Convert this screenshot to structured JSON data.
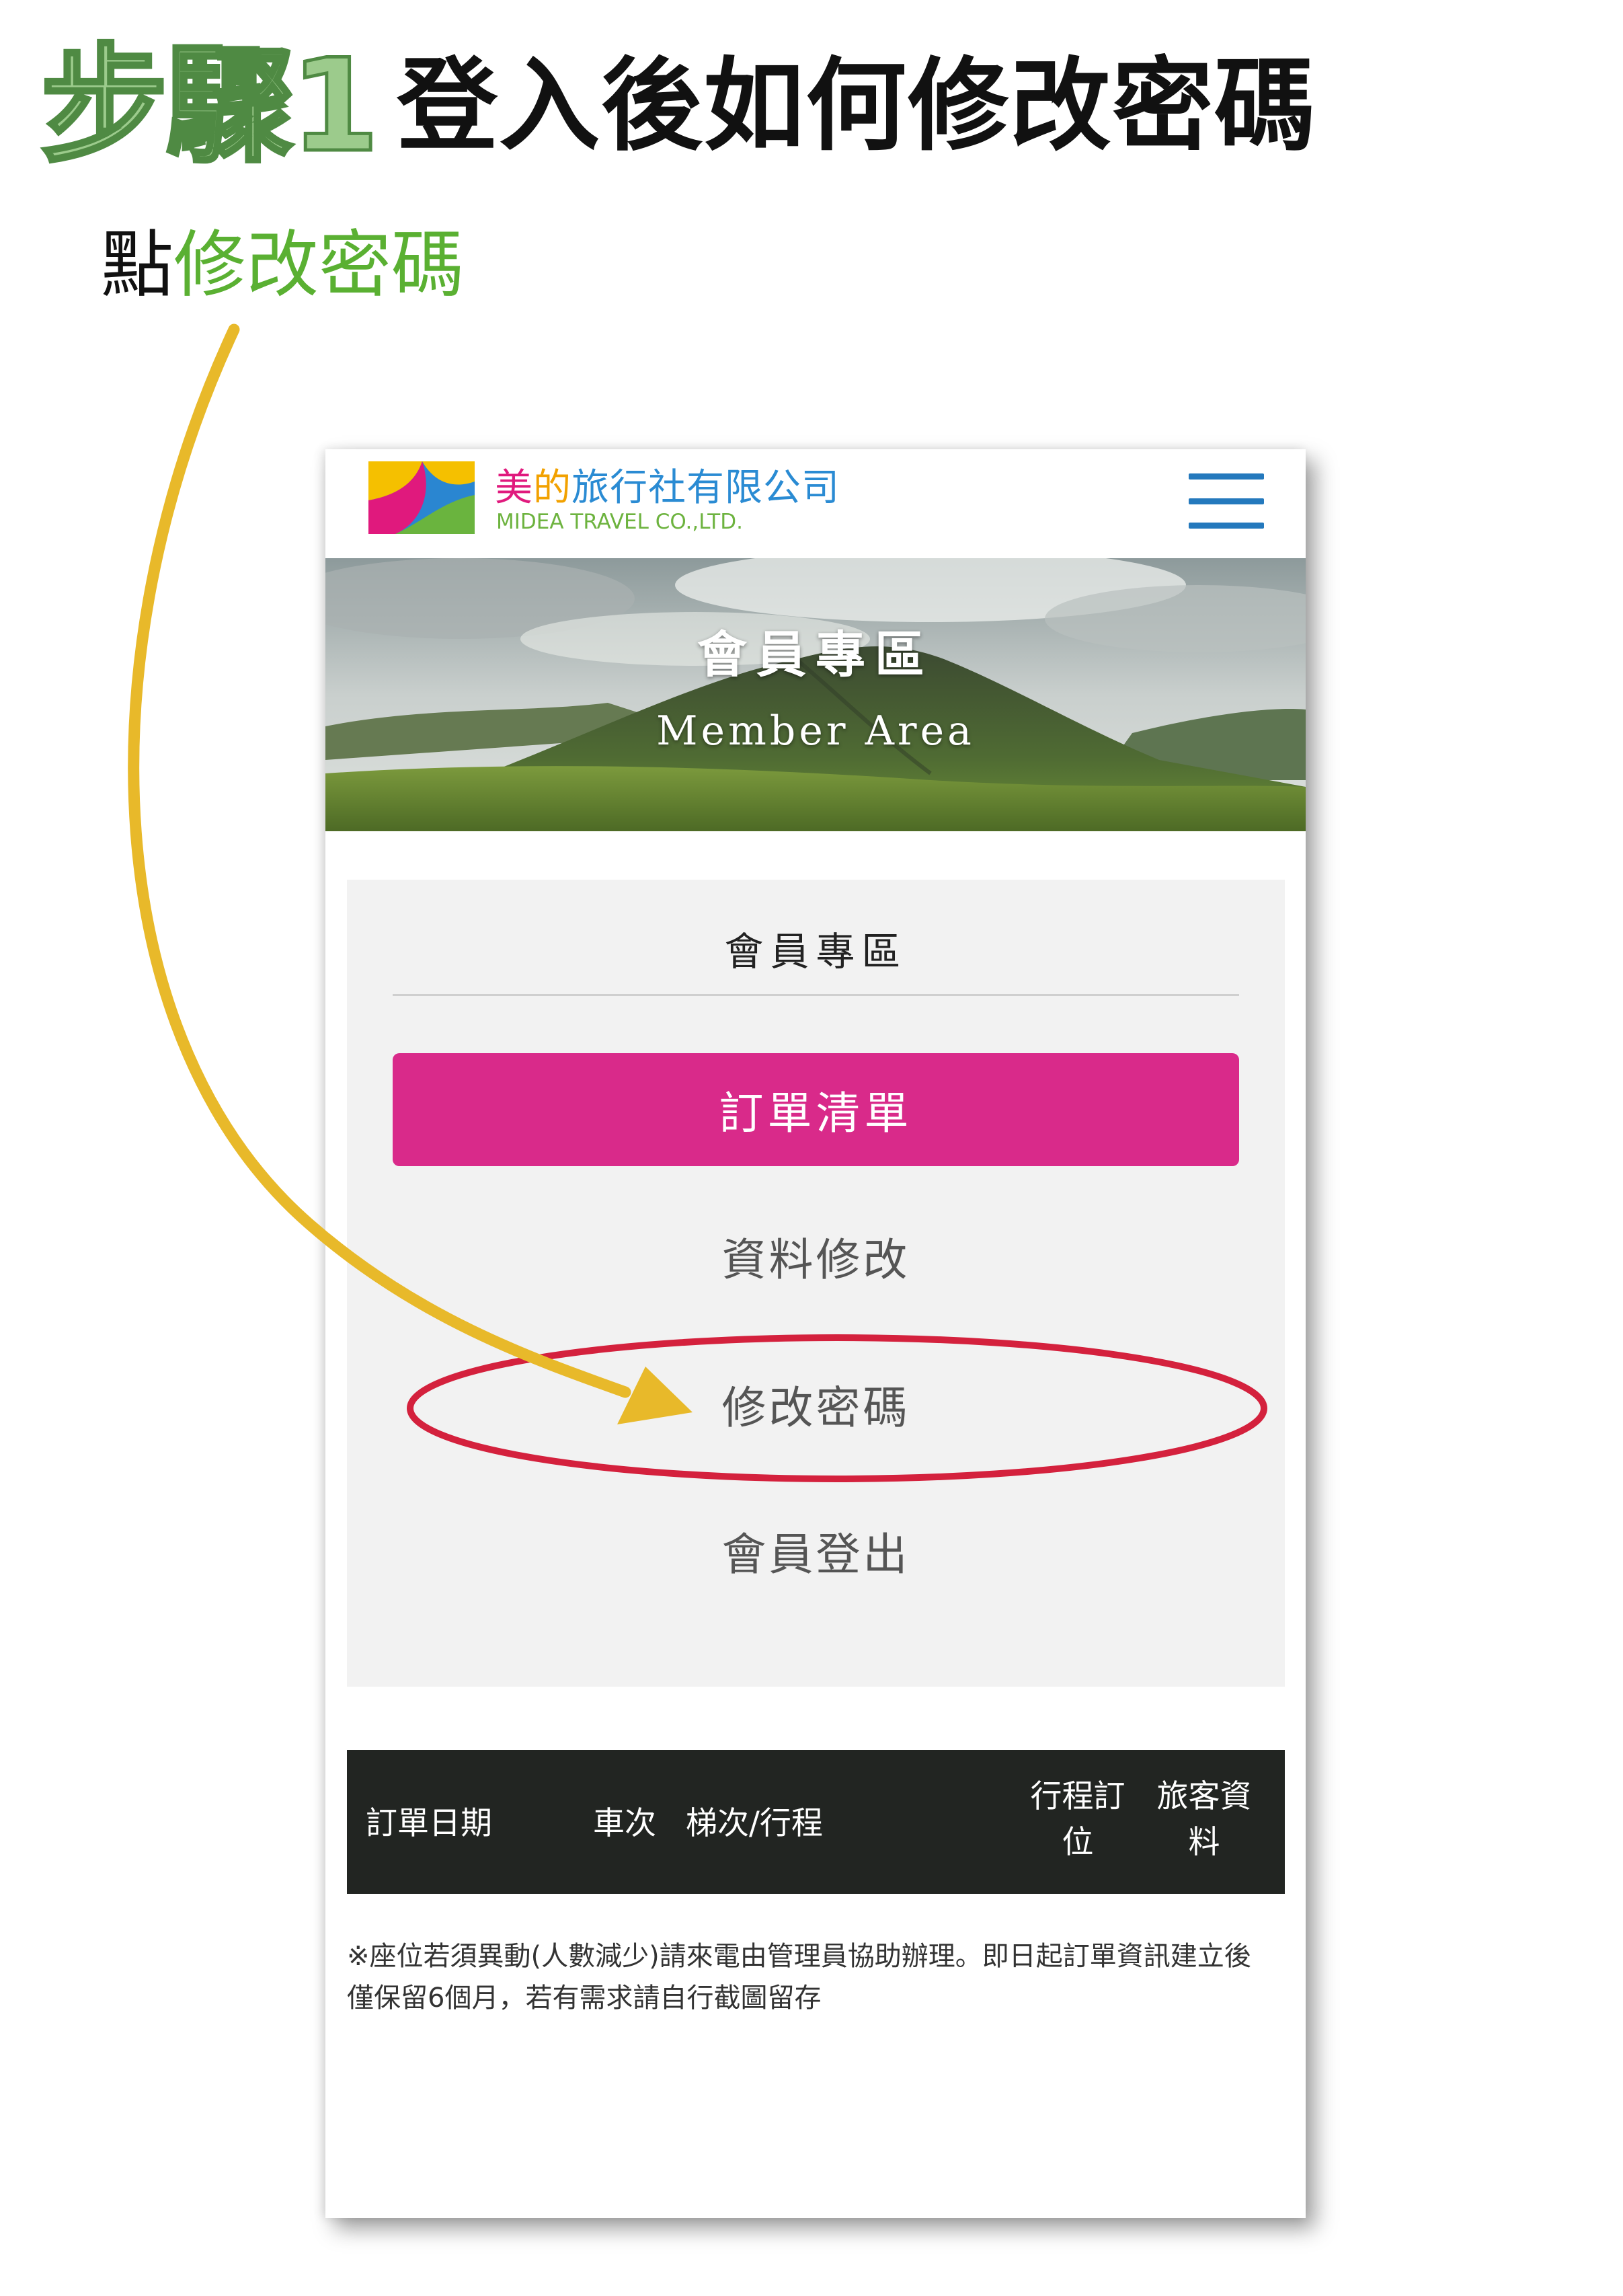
{
  "instruction": {
    "step_label": "步驟1",
    "heading": "登入後如何修改密碼",
    "action_verb": "點",
    "action_target": "修改密碼"
  },
  "site": {
    "brand_zh_1": "美",
    "brand_zh_2": "的",
    "brand_zh_3": "旅行社有限公司",
    "brand_en": "MIDEA TRAVEL  CO.,LTD.",
    "menu_icon": "hamburger-menu-icon"
  },
  "banner": {
    "title": "會員專區",
    "subtitle": "Member Area"
  },
  "member_menu": {
    "title": "會員專區",
    "order_list": "訂單清單",
    "edit_profile": "資料修改",
    "change_password": "修改密碼",
    "logout": "會員登出"
  },
  "order_table": {
    "headers": {
      "date": "訂單日期",
      "car": "車次",
      "trip": "梯次/行程",
      "booking_line1": "行程訂",
      "booking_line2": "位",
      "passenger_line1": "旅客資",
      "passenger_line2": "料"
    }
  },
  "note": {
    "line1": "※座位若須異動(人數減少)請來電由管理員協助辦理。即日起訂單資訊建立後",
    "line2": "僅保留6個月，若有需求請自行截圖留存"
  },
  "colors": {
    "step_green": "#9ccb8c",
    "instruction_green": "#5ab032",
    "brand_magenta": "#d92a8a",
    "hamburger_blue": "#2479bd",
    "arrow_yellow": "#e8b92a",
    "highlight_red": "#d4213d",
    "table_header_bg": "#222522"
  }
}
